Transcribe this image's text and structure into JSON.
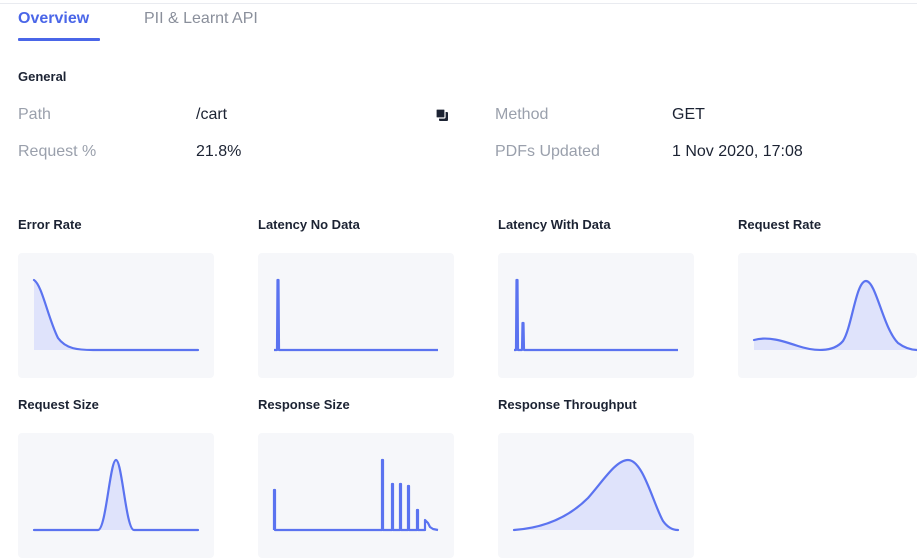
{
  "tabs": [
    {
      "label": "Overview",
      "active": true
    },
    {
      "label": "PII & Learnt API",
      "active": false
    }
  ],
  "general": {
    "title": "General",
    "path_label": "Path",
    "path_value": "/cart",
    "request_label": "Request %",
    "request_value": "21.8%",
    "method_label": "Method",
    "method_value": "GET",
    "pdfs_label": "PDFs Updated",
    "pdfs_value": "1 Nov 2020, 17:08",
    "copy_icon": "copy-icon"
  },
  "colors": {
    "accent": "#4a66e8",
    "chart_line": "#5b73f0",
    "chart_fill": "#dfe3fb",
    "chart_bg": "#f6f7fa",
    "label_gray": "#9aa0ac",
    "text_dark": "#1c2333"
  },
  "charts": [
    {
      "title": "Error Rate"
    },
    {
      "title": "Latency No Data"
    },
    {
      "title": "Latency With Data"
    },
    {
      "title": "Request Rate"
    },
    {
      "title": "Request Size"
    },
    {
      "title": "Response Size"
    },
    {
      "title": "Response Throughput"
    }
  ]
}
